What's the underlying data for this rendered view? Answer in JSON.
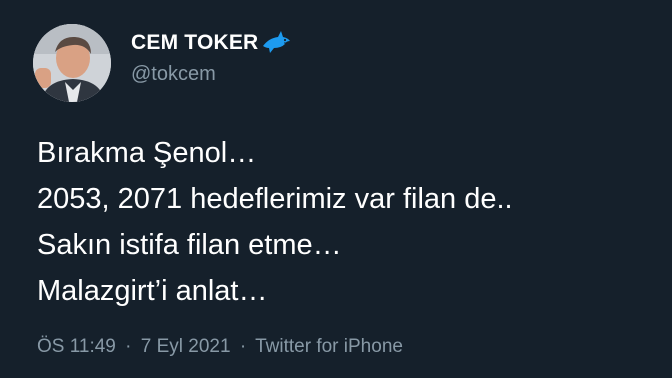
{
  "author": {
    "display_name": "CEM TOKER",
    "handle": "@tokcem",
    "badge_icon": "shark-icon"
  },
  "tweet": {
    "lines": [
      "Bırakma Şenol…",
      "2053, 2071 hedeflerimiz var filan de..",
      "Sakın istifa filan etme…",
      "Malazgirt’i anlat…"
    ]
  },
  "meta": {
    "time": "ÖS 11:49",
    "separator": "·",
    "date": "7 Eyl 2021",
    "source": "Twitter for iPhone"
  },
  "colors": {
    "background": "#15202b",
    "text": "#ffffff",
    "secondary_text": "#8899a6",
    "accent": "#1d9bf0"
  }
}
